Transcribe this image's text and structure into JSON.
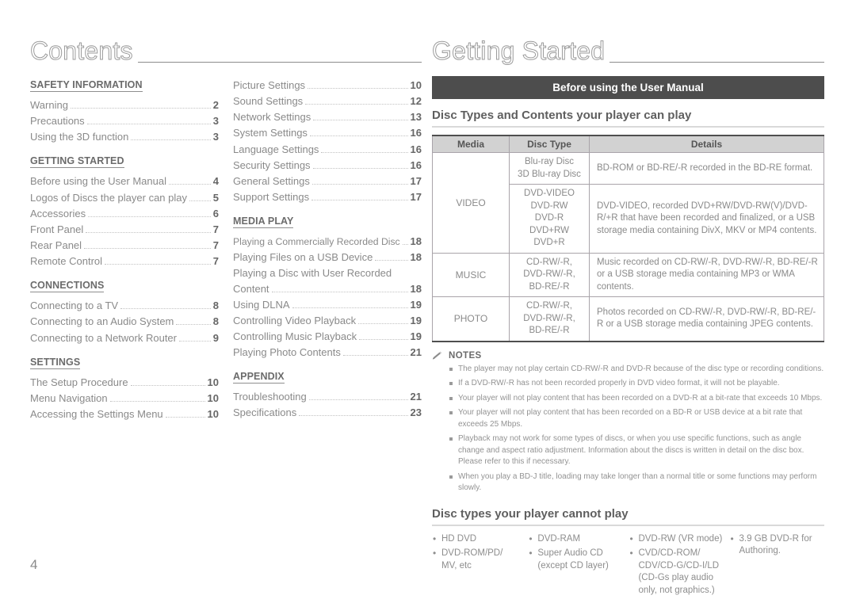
{
  "left_page": {
    "title": "Contents",
    "page_number": "4",
    "columns": [
      {
        "blocks": [
          {
            "heading": "SAFETY INFORMATION",
            "entries": [
              {
                "label": "Warning",
                "page": "2"
              },
              {
                "label": "Precautions",
                "page": "3"
              },
              {
                "label": "Using the 3D function",
                "page": "3"
              }
            ]
          },
          {
            "heading": "GETTING STARTED",
            "entries": [
              {
                "label": "Before using the User Manual",
                "page": "4"
              },
              {
                "label": "Logos of Discs the player can play",
                "page": "5"
              },
              {
                "label": "Accessories",
                "page": "6"
              },
              {
                "label": "Front Panel",
                "page": "7"
              },
              {
                "label": "Rear Panel",
                "page": "7"
              },
              {
                "label": "Remote Control",
                "page": "7"
              }
            ]
          },
          {
            "heading": "CONNECTIONS",
            "entries": [
              {
                "label": "Connecting to a TV",
                "page": "8"
              },
              {
                "label": "Connecting to an Audio System",
                "page": "8"
              },
              {
                "label": "Connecting to a Network Router",
                "page": "9"
              }
            ]
          },
          {
            "heading": "SETTINGS",
            "entries": [
              {
                "label": "The Setup Procedure",
                "page": "10"
              },
              {
                "label": "Menu Navigation",
                "page": "10"
              },
              {
                "label": "Accessing the Settings Menu",
                "page": "10"
              }
            ]
          }
        ]
      },
      {
        "blocks": [
          {
            "heading": "",
            "entries": [
              {
                "label": "Picture Settings",
                "page": "10"
              },
              {
                "label": "Sound Settings",
                "page": "12"
              },
              {
                "label": "Network Settings",
                "page": "13"
              },
              {
                "label": "System Settings",
                "page": "16"
              },
              {
                "label": "Language Settings",
                "page": "16"
              },
              {
                "label": "Security Settings",
                "page": "16"
              },
              {
                "label": "General Settings",
                "page": "17"
              },
              {
                "label": "Support Settings",
                "page": "17"
              }
            ]
          },
          {
            "heading": "MEDIA PLAY",
            "entries": [
              {
                "label": "Playing a Commercially Recorded Disc",
                "page": "18"
              },
              {
                "label": "Playing Files on a USB Device",
                "page": "18"
              },
              {
                "label": "Playing a Disc with User Recorded Content",
                "page": "18",
                "two_line": true
              },
              {
                "label": "Using DLNA",
                "page": "19"
              },
              {
                "label": "Controlling Video Playback",
                "page": "19"
              },
              {
                "label": "Controlling Music Playback",
                "page": "19"
              },
              {
                "label": "Playing Photo Contents",
                "page": "21"
              }
            ]
          },
          {
            "heading": "APPENDIX",
            "entries": [
              {
                "label": "Troubleshooting",
                "page": "21"
              },
              {
                "label": "Specifications",
                "page": "23"
              }
            ]
          }
        ]
      }
    ]
  },
  "right_page": {
    "title": "Getting Started",
    "banner": "Before using the User Manual",
    "section1_heading": "Disc Types and Contents your player can play",
    "table": {
      "headers": [
        "Media",
        "Disc Type",
        "Details"
      ],
      "rows": [
        {
          "media": "VIDEO",
          "media_rowspan": 2,
          "disc_types": [
            "Blu-ray Disc",
            "3D Blu-ray Disc"
          ],
          "details": "BD-ROM or BD-RE/-R recorded in the BD-RE format."
        },
        {
          "media": "",
          "disc_types": [
            "DVD-VIDEO",
            "DVD-RW",
            "DVD-R",
            "DVD+RW",
            "DVD+R"
          ],
          "details": "DVD-VIDEO, recorded DVD+RW/DVD-RW(V)/DVD-R/+R that have been recorded and finalized, or a USB storage media containing DivX, MKV or MP4 contents."
        },
        {
          "media": "MUSIC",
          "disc_types": [
            "CD-RW/-R,",
            "DVD-RW/-R,",
            "BD-RE/-R"
          ],
          "details": "Music recorded on CD-RW/-R, DVD-RW/-R, BD-RE/-R or a USB storage media containing MP3 or WMA contents."
        },
        {
          "media": "PHOTO",
          "disc_types": [
            "CD-RW/-R,",
            "DVD-RW/-R,",
            "BD-RE/-R"
          ],
          "details": "Photos recorded on CD-RW/-R, DVD-RW/-R, BD-RE/-R or a USB storage media containing JPEG contents."
        }
      ]
    },
    "notes_label": "NOTES",
    "notes": [
      "The player may not play certain CD-RW/-R and DVD-R because of the disc type or recording conditions.",
      "If a DVD-RW/-R has not been recorded properly in DVD video format, it will not be playable.",
      "Your player will not play content that has been recorded on a DVD-R at a bit-rate that exceeds 10 Mbps.",
      "Your player will not play content that has been recorded on a BD-R or USB device at a bit rate that exceeds 25 Mbps.",
      "Playback may not work for some types of discs, or when you use specific functions, such as angle change and aspect ratio adjustment. Information about the discs is written in detail on the disc box. Please refer to this if necessary.",
      "When you play a BD-J title, loading may take longer than a normal title or some functions may perform slowly."
    ],
    "section2_heading": "Disc types your player cannot play",
    "cannot_play": [
      {
        "items": [
          "HD DVD",
          "DVD-ROM/PD/"
        ],
        "cont": [
          "MV, etc"
        ]
      },
      {
        "items": [
          "DVD-RAM",
          "Super Audio CD"
        ],
        "cont": [
          "(except CD layer)"
        ]
      },
      {
        "items": [
          "DVD-RW (VR mode)",
          "CVD/CD-ROM/"
        ],
        "cont": [
          "CDV/CD-G/CD-I/LD",
          "(CD-Gs play audio",
          "only, not graphics.)"
        ]
      },
      {
        "items": [
          "3.9 GB DVD-R for"
        ],
        "cont": [
          "Authoring."
        ]
      }
    ]
  },
  "colors": {
    "banner_bg": "#4d4d4d",
    "table_header_bg": "#d2d2d2",
    "body_text": "#8a8a8a",
    "rule": "#8c8c8c"
  }
}
